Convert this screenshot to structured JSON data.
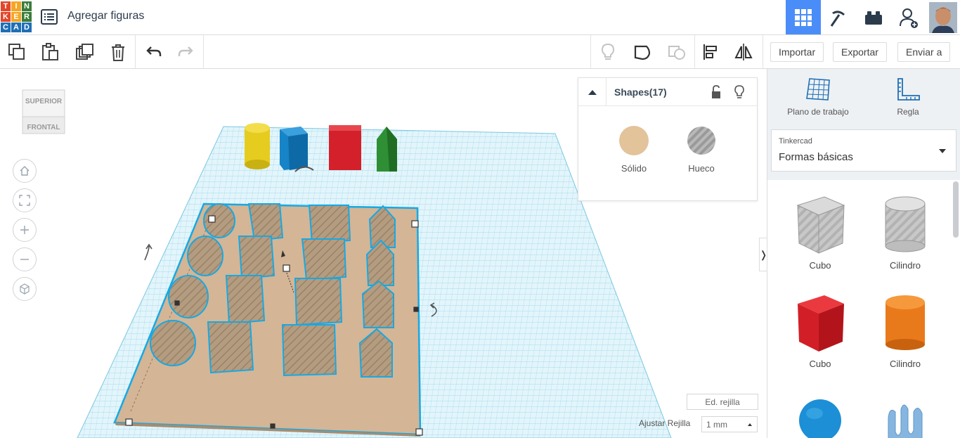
{
  "app": {
    "logo_letters": [
      "T",
      "I",
      "N",
      "K",
      "E",
      "R",
      "C",
      "A",
      "D"
    ],
    "logo_colors": [
      "#e2462b",
      "#f5a623",
      "#3a7d3a",
      "#e2462b",
      "#f5a623",
      "#3a7d3a",
      "#1f6fb5",
      "#1f6fb5",
      "#1f6fb5"
    ],
    "title": "Agregar figuras",
    "accent": "#4b8df8"
  },
  "topbar": {
    "icons": [
      "grid-view-icon",
      "pickaxe-icon",
      "bricks-icon",
      "add-user-icon",
      "user-avatar"
    ]
  },
  "toolbar": {
    "import_label": "Importar",
    "export_label": "Exportar",
    "send_label": "Enviar a"
  },
  "viewcube": {
    "top_label": "SUPERIOR",
    "front_label": "FRONTAL"
  },
  "inspector": {
    "title": "Shapes(17)",
    "solid_label": "Sólido",
    "hole_label": "Hueco",
    "solid_color": "#e2c39a"
  },
  "bottom": {
    "edit_grid_label": "Ed. rejilla",
    "snap_label": "Ajustar Rejilla",
    "snap_value": "1 mm"
  },
  "sidebar": {
    "workplane_label": "Plano de trabajo",
    "ruler_label": "Regla",
    "library_caption": "Tinkercad",
    "library_name": "Formas básicas",
    "shapes": [
      {
        "label": "Cubo",
        "kind": "hole-cube"
      },
      {
        "label": "Cilindro",
        "kind": "hole-cylinder"
      },
      {
        "label": "Cubo",
        "kind": "cube",
        "color": "#d8232a"
      },
      {
        "label": "Cilindro",
        "kind": "cylinder",
        "color": "#e97a1c"
      },
      {
        "label": "",
        "kind": "sphere",
        "color": "#1c8fd6"
      },
      {
        "label": "",
        "kind": "scribble",
        "color": "#6fa8dc"
      }
    ]
  }
}
